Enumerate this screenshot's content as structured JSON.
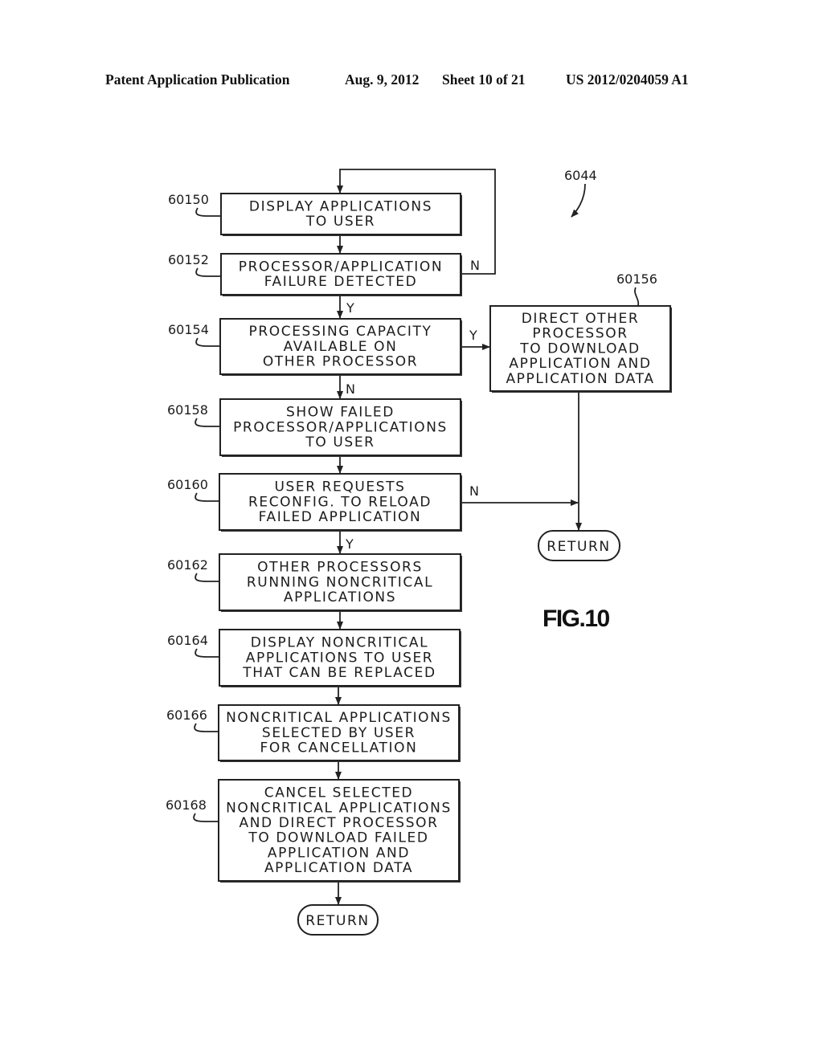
{
  "header": {
    "publication": "Patent Application Publication",
    "date": "Aug. 9, 2012",
    "sheet": "Sheet 10 of 21",
    "number": "US 2012/0204059 A1"
  },
  "figure": {
    "label": "FIG.10",
    "ref": "6044"
  },
  "steps": [
    {
      "id": "60150",
      "lines": [
        "DISPLAY APPLICATIONS",
        "TO USER"
      ]
    },
    {
      "id": "60152",
      "lines": [
        "PROCESSOR/APPLICATION",
        "FAILURE DETECTED"
      ]
    },
    {
      "id": "60154",
      "lines": [
        "PROCESSING CAPACITY",
        "AVAILABLE ON",
        "OTHER PROCESSOR"
      ]
    },
    {
      "id": "60156",
      "lines": [
        "DIRECT OTHER",
        "PROCESSOR",
        "TO DOWNLOAD",
        "APPLICATION AND",
        "APPLICATION DATA"
      ]
    },
    {
      "id": "60158",
      "lines": [
        "SHOW FAILED",
        "PROCESSOR/APPLICATIONS",
        "TO USER"
      ]
    },
    {
      "id": "60160",
      "lines": [
        "USER REQUESTS",
        "RECONFIG. TO RELOAD",
        "FAILED APPLICATION"
      ]
    },
    {
      "id": "60162",
      "lines": [
        "OTHER PROCESSORS",
        "RUNNING NONCRITICAL",
        "APPLICATIONS"
      ]
    },
    {
      "id": "60164",
      "lines": [
        "DISPLAY NONCRITICAL",
        "APPLICATIONS TO USER",
        "THAT CAN BE REPLACED"
      ]
    },
    {
      "id": "60166",
      "lines": [
        "NONCRITICAL APPLICATIONS",
        "SELECTED BY USER",
        "FOR CANCELLATION"
      ]
    },
    {
      "id": "60168",
      "lines": [
        "CANCEL SELECTED",
        "NONCRITICAL APPLICATIONS",
        "AND DIRECT PROCESSOR",
        "TO DOWNLOAD FAILED",
        "APPLICATION AND",
        "APPLICATION DATA"
      ]
    }
  ],
  "terminals": {
    "return_right": "RETURN",
    "return_bottom": "RETURN"
  },
  "branch_labels": {
    "yes": "Y",
    "no": "N"
  }
}
